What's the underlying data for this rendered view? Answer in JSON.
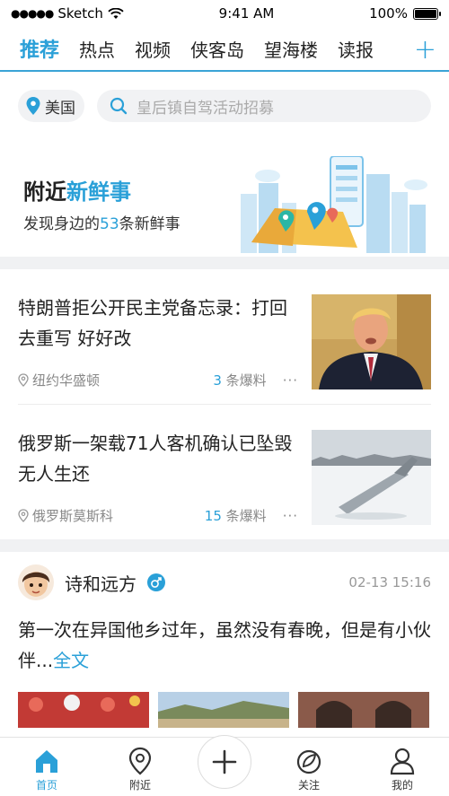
{
  "status_bar": {
    "carrier": "Sketch",
    "time": "9:41 AM",
    "battery": "100%"
  },
  "tabs": [
    {
      "label": "推荐",
      "active": true
    },
    {
      "label": "热点"
    },
    {
      "label": "视频"
    },
    {
      "label": "侠客岛"
    },
    {
      "label": "望海楼"
    },
    {
      "label": "读报"
    }
  ],
  "tabs_add": "+",
  "location": {
    "label": "美国"
  },
  "search": {
    "placeholder": "皇后镇自驾活动招募"
  },
  "banner": {
    "title_prefix": "附近",
    "title_highlight": "新鲜事",
    "sub_prefix": "发现身边的",
    "sub_count": "53",
    "sub_suffix": "条新鲜事"
  },
  "news": [
    {
      "title": "特朗普拒公开民主党备忘录：打回去重写 好好改",
      "place": "纽约华盛顿",
      "count": "3",
      "count_suffix": "条爆料",
      "more": "···"
    },
    {
      "title": "俄罗斯一架载71人客机确认已坠毁 无人生还",
      "place": "俄罗斯莫斯科",
      "count": "15",
      "count_suffix": "条爆料",
      "more": "···"
    }
  ],
  "post": {
    "author": "诗和远方",
    "time": "02-13 15:16",
    "body": "第一次在异国他乡过年，虽然没有春晚，但是有小伙伴...",
    "full_link": "全文"
  },
  "bottom_nav": [
    {
      "label": "首页",
      "icon": "home-icon",
      "active": true
    },
    {
      "label": "附近",
      "icon": "location-icon"
    },
    {
      "label": "",
      "icon": "plus-icon"
    },
    {
      "label": "关注",
      "icon": "follow-icon"
    },
    {
      "label": "我的",
      "icon": "user-icon"
    }
  ],
  "colors": {
    "accent": "#2aa0d8",
    "separator": "#f0f1f3",
    "pill_bg": "#f1f2f4"
  }
}
